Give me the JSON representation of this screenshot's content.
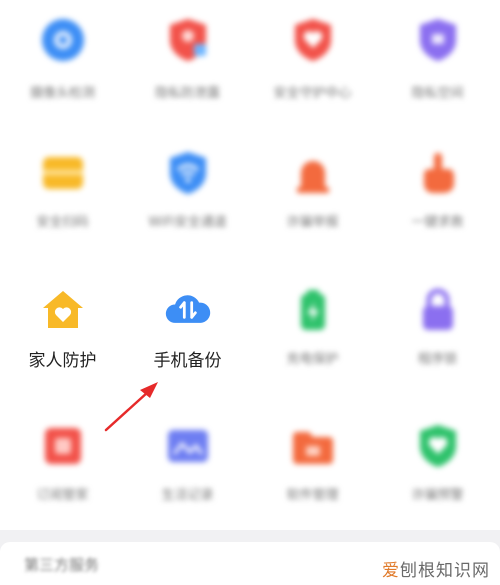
{
  "colors": {
    "blue": "#3d8ef5",
    "red": "#f2524a",
    "orange_red": "#f36a3e",
    "purple": "#8b6ff0",
    "yellow": "#f8b928",
    "green": "#2ec26b",
    "arrow": "#e62a2a"
  },
  "tiles": [
    {
      "label": "摄像头检测",
      "icon": "camera-detect-icon"
    },
    {
      "label": "隐私防泄露",
      "icon": "privacy-shield-icon"
    },
    {
      "label": "安全守护中心",
      "icon": "shield-heart-icon"
    },
    {
      "label": "隐私空间",
      "icon": "privacy-space-icon"
    },
    {
      "label": "安全扫码",
      "icon": "scan-code-icon"
    },
    {
      "label": "WiFi安全通道",
      "icon": "wifi-shield-icon"
    },
    {
      "label": "诈骗举报",
      "icon": "alarm-icon"
    },
    {
      "label": "一键求救",
      "icon": "sos-hand-icon"
    },
    {
      "label": "家人防护",
      "icon": "family-home-icon"
    },
    {
      "label": "手机备份",
      "icon": "cloud-backup-icon"
    },
    {
      "label": "充电保护",
      "icon": "charge-protect-icon"
    },
    {
      "label": "程序锁",
      "icon": "app-lock-icon"
    },
    {
      "label": "订阅管家",
      "icon": "subscription-icon"
    },
    {
      "label": "生活记录",
      "icon": "life-record-icon"
    },
    {
      "label": "软件管理",
      "icon": "software-manage-icon"
    },
    {
      "label": "诈骗预警",
      "icon": "fraud-warning-icon"
    }
  ],
  "section": {
    "title": "第三方服务"
  },
  "watermark": {
    "part1": "爱",
    "part2": "刨根知识网"
  }
}
